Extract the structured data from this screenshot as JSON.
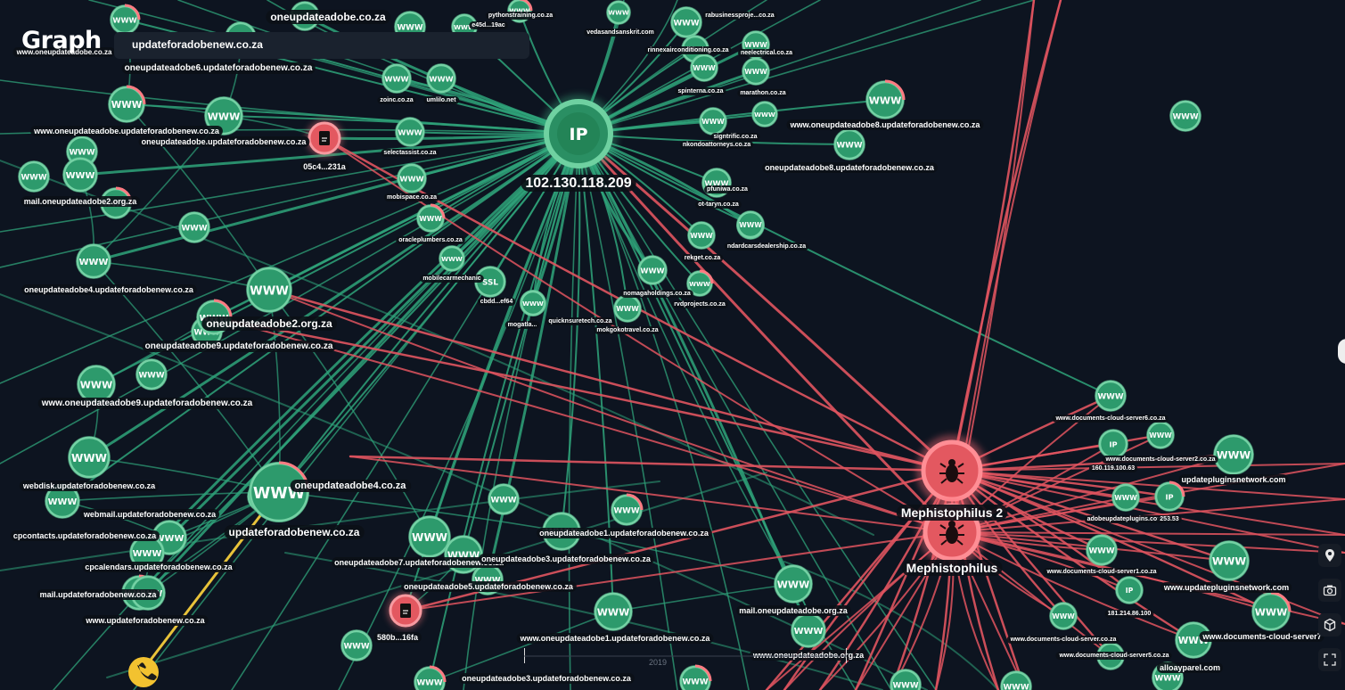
{
  "app": {
    "title": "Graph"
  },
  "search": {
    "value": "updateforadobenew.co.za"
  },
  "colors": {
    "background": "#0d1420",
    "green_edge": "#2fa37a",
    "red_edge": "#e0545f",
    "yellow_edge": "#e8c33a",
    "node_green": "#2d9a6c",
    "node_red": "#e35860",
    "label_bg": "#0b0f16"
  },
  "hubs": [
    {
      "id": "ip-hub",
      "kind": "IP",
      "label": "102.130.118.209",
      "color": "green"
    },
    {
      "id": "meph2",
      "kind": "malware",
      "label": "Mephistophilus 2",
      "color": "red"
    },
    {
      "id": "meph",
      "kind": "malware",
      "label": "Mephistophilus",
      "color": "red"
    }
  ],
  "nodes": [
    {
      "label": "oneupdateadobe.co.za",
      "kind": "WWW"
    },
    {
      "label": "pythonstraining.co.za",
      "kind": "WWW"
    },
    {
      "label": "e45d...19ac",
      "kind": "WWW"
    },
    {
      "label": "vedasandsanskrit.com",
      "kind": "WWW"
    },
    {
      "label": "rabusinessproje...co.za",
      "kind": "WWW"
    },
    {
      "label": "rinnexairconditioning.co.za",
      "kind": "WWW"
    },
    {
      "label": "neelectrical.co.za",
      "kind": "WWW"
    },
    {
      "label": "www.oneupdateadobe.co.za",
      "kind": "WWW"
    },
    {
      "label": "oneupdateadobe6.updateforadobenew.co.za",
      "kind": "WWW"
    },
    {
      "label": "zoinc.co.za",
      "kind": "WWW"
    },
    {
      "label": "umlilo.net",
      "kind": "WWW"
    },
    {
      "label": "spinterna.co.za",
      "kind": "WWW"
    },
    {
      "label": "marathon.co.za",
      "kind": "WWW"
    },
    {
      "label": "www.oneupdateadobe.updateforadobenew.co.za",
      "kind": "WWW"
    },
    {
      "label": "oneupdateadobe.updateforadobenew.co.za",
      "kind": "WWW"
    },
    {
      "label": "05c4...231a",
      "kind": "file"
    },
    {
      "label": "selectassist.co.za",
      "kind": "WWW"
    },
    {
      "label": "signtrific.co.za",
      "kind": "WWW"
    },
    {
      "label": "nkondoattorneys.co.za",
      "kind": "WWW"
    },
    {
      "label": "www.oneupdateadobe8.updateforadobenew.co.za",
      "kind": "WWW"
    },
    {
      "label": "oneupdateadobe8.updateforadobenew.co.za",
      "kind": "WWW"
    },
    {
      "label": "mail.oneupdateadobe2.org.za",
      "kind": "WWW"
    },
    {
      "label": "mobispace.co.za",
      "kind": "WWW"
    },
    {
      "label": "pfuniwa.co.za",
      "kind": "WWW"
    },
    {
      "label": "ot-taryn.co.za",
      "kind": "WWW"
    },
    {
      "label": "oracleplumbers.co.za",
      "kind": "WWW"
    },
    {
      "label": "ndardcarsdealership.co.za",
      "kind": "WWW"
    },
    {
      "label": "oneupdateadobe4.updateforadobenew.co.za",
      "kind": "WWW"
    },
    {
      "label": "rekget.co.za",
      "kind": "WWW"
    },
    {
      "label": "mobilecarmechanic",
      "kind": "WWW"
    },
    {
      "label": "nomagaholdings.co.za",
      "kind": "WWW"
    },
    {
      "label": "rvdprojects.co.za",
      "kind": "WWW"
    },
    {
      "label": "cbdd...ef64",
      "kind": "SSL"
    },
    {
      "label": "quicknsuretech.co.za",
      "kind": "WWW"
    },
    {
      "label": "mokgokotravel.co.za",
      "kind": "WWW"
    },
    {
      "label": "mogatla...",
      "kind": "WWW"
    },
    {
      "label": "oneupdateadobe2.org.za",
      "kind": "WWW"
    },
    {
      "label": "oneupdateadobe9.updateforadobenew.co.za",
      "kind": "WWW"
    },
    {
      "label": "www.oneupdateadobe9.updateforadobenew.co.za",
      "kind": "WWW"
    },
    {
      "label": "webdisk.updateforadobenew.co.za",
      "kind": "WWW"
    },
    {
      "label": "oneupdateadobe4.co.za",
      "kind": "WWW"
    },
    {
      "label": "webmail.updateforadobenew.co.za",
      "kind": "WWW"
    },
    {
      "label": "cpcontacts.updateforadobenew.co.za",
      "kind": "WWW"
    },
    {
      "label": "updateforadobenew.co.za",
      "kind": "WWW"
    },
    {
      "label": "oneupdateadobe1.updateforadobenew.co.za",
      "kind": "WWW"
    },
    {
      "label": "cpcalendars.updateforadobenew.co.za",
      "kind": "WWW"
    },
    {
      "label": "oneupdateadobe7.updateforadobenew.co.za",
      "kind": "WWW"
    },
    {
      "label": "oneupdateadobe3.updateforadobenew.co.za",
      "kind": "WWW"
    },
    {
      "label": "oneupdateadobe5.updateforadobenew.co.za",
      "kind": "WWW"
    },
    {
      "label": "mail.updateforadobenew.co.za",
      "kind": "WWW"
    },
    {
      "label": "580b...16fa",
      "kind": "file"
    },
    {
      "label": "www.updateforadobenew.co.za",
      "kind": "WWW"
    },
    {
      "label": "mail.oneupdateadobe.org.za",
      "kind": "WWW"
    },
    {
      "label": "www.oneupdateadobe1.updateforadobenew.co.za",
      "kind": "WWW"
    },
    {
      "label": "www.oneupdateadobe.org.za",
      "kind": "WWW"
    },
    {
      "label": "oneupdateadobe3.updateforadobenew.co.za",
      "kind": "WWW"
    },
    {
      "label": "www.documents-cloud-server6.co.za",
      "kind": "WWW"
    },
    {
      "label": "www.documents-cloud-server2.co.za",
      "kind": "WWW"
    },
    {
      "label": "160.119.100.63",
      "kind": "IP"
    },
    {
      "label": "updatepluginsnetwork.com",
      "kind": "WWW"
    },
    {
      "label": "adobeupdateplugins.com",
      "kind": "WWW"
    },
    {
      "label": "253.53",
      "kind": "IP"
    },
    {
      "label": "www.documents-cloud-server1.co.za",
      "kind": "WWW"
    },
    {
      "label": "www.updatepluginsnetwork.com",
      "kind": "WWW"
    },
    {
      "label": "181.214.86.100",
      "kind": "IP"
    },
    {
      "label": "www.documents-cloud-server.co.za",
      "kind": "WWW"
    },
    {
      "label": "www.documents-cloud-server5.co.za",
      "kind": "WWW"
    },
    {
      "label": "www.documents-cloud-server7",
      "kind": "WWW"
    },
    {
      "label": "alloayparel.com",
      "kind": "WWW"
    }
  ],
  "toolbar": [
    {
      "id": "location-button",
      "icon": "map-pin-icon"
    },
    {
      "id": "screenshot-button",
      "icon": "camera-icon"
    },
    {
      "id": "3d-button",
      "icon": "cube-icon"
    },
    {
      "id": "fullscreen-button",
      "icon": "expand-icon"
    }
  ],
  "timeline": {
    "year_label": "2019"
  }
}
